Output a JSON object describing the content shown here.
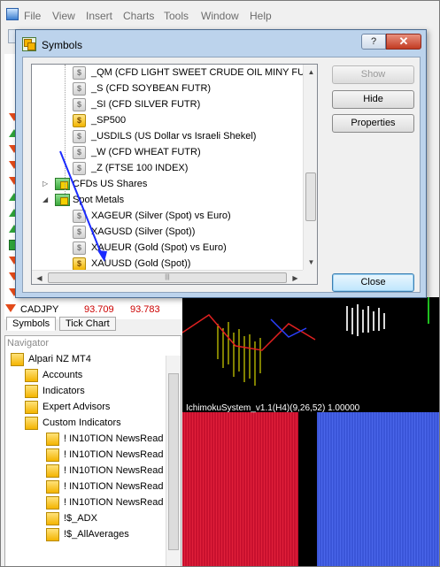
{
  "menu": [
    "File",
    "View",
    "Insert",
    "Charts",
    "Tools",
    "Window",
    "Help"
  ],
  "market_watch": {
    "row": {
      "symbol": "CADJPY",
      "bid": "93.709",
      "ask": "93.783"
    },
    "tabs": [
      "Symbols",
      "Tick Chart"
    ]
  },
  "navigator": {
    "title": "Navigator",
    "items": [
      {
        "label": "Alpari NZ MT4",
        "icon": "terminal-icon"
      },
      {
        "label": "Accounts",
        "icon": "accounts-icon"
      },
      {
        "label": "Indicators",
        "icon": "indicators-icon"
      },
      {
        "label": "Expert Advisors",
        "icon": "expert-advisors-icon"
      },
      {
        "label": "Custom Indicators",
        "icon": "custom-indicators-icon"
      },
      {
        "label": "! IN10TION NewsRead",
        "icon": "indicator-icon"
      },
      {
        "label": "! IN10TION NewsRead",
        "icon": "indicator-icon"
      },
      {
        "label": "! IN10TION NewsRead",
        "icon": "indicator-icon"
      },
      {
        "label": "! IN10TION NewsRead",
        "icon": "indicator-icon"
      },
      {
        "label": "! IN10TION NewsRead",
        "icon": "indicator-icon"
      },
      {
        "label": "!$_ADX",
        "icon": "indicator-icon"
      },
      {
        "label": "!$_AllAverages",
        "icon": "indicator-icon"
      }
    ]
  },
  "chart": {
    "subwindow_label": "IchimokuSystem_v1.1(H4)(9,26,52) 1.00000",
    "colors": {
      "red": "#c8102e",
      "blue": "#3a55d8"
    }
  },
  "dialog": {
    "title": "Symbols",
    "help_label": "?",
    "close_label": "✕",
    "tree": [
      {
        "text": "_QM  (CFD LIGHT SWEET CRUDE OIL MINY FUTR)",
        "active": false
      },
      {
        "text": "_S  (CFD SOYBEAN FUTR)",
        "active": false
      },
      {
        "text": "_SI  (CFD SILVER FUTR)",
        "active": false
      },
      {
        "text": "_SP500",
        "active": true
      },
      {
        "text": "_USDILS  (US Dollar vs Israeli Shekel)",
        "active": false
      },
      {
        "text": "_W  (CFD WHEAT FUTR)",
        "active": false
      },
      {
        "text": "_Z  (FTSE 100 INDEX)",
        "active": false
      },
      {
        "text": "CFDs US Shares",
        "folder": true,
        "expanded": false
      },
      {
        "text": "Spot Metals",
        "folder": true,
        "expanded": true
      },
      {
        "text": "XAGEUR  (Silver (Spot) vs Euro)",
        "active": false
      },
      {
        "text": "XAGUSD  (Silver (Spot))",
        "active": false
      },
      {
        "text": "XAUEUR  (Gold (Spot) vs Euro)",
        "active": false
      },
      {
        "text": "XAUUSD  (Gold (Spot))",
        "active": true
      }
    ],
    "buttons": {
      "show": "Show",
      "hide": "Hide",
      "properties": "Properties",
      "close": "Close"
    },
    "symbol_glyph": "$",
    "expand_glyph": "▷",
    "collapse_glyph": "◢"
  }
}
